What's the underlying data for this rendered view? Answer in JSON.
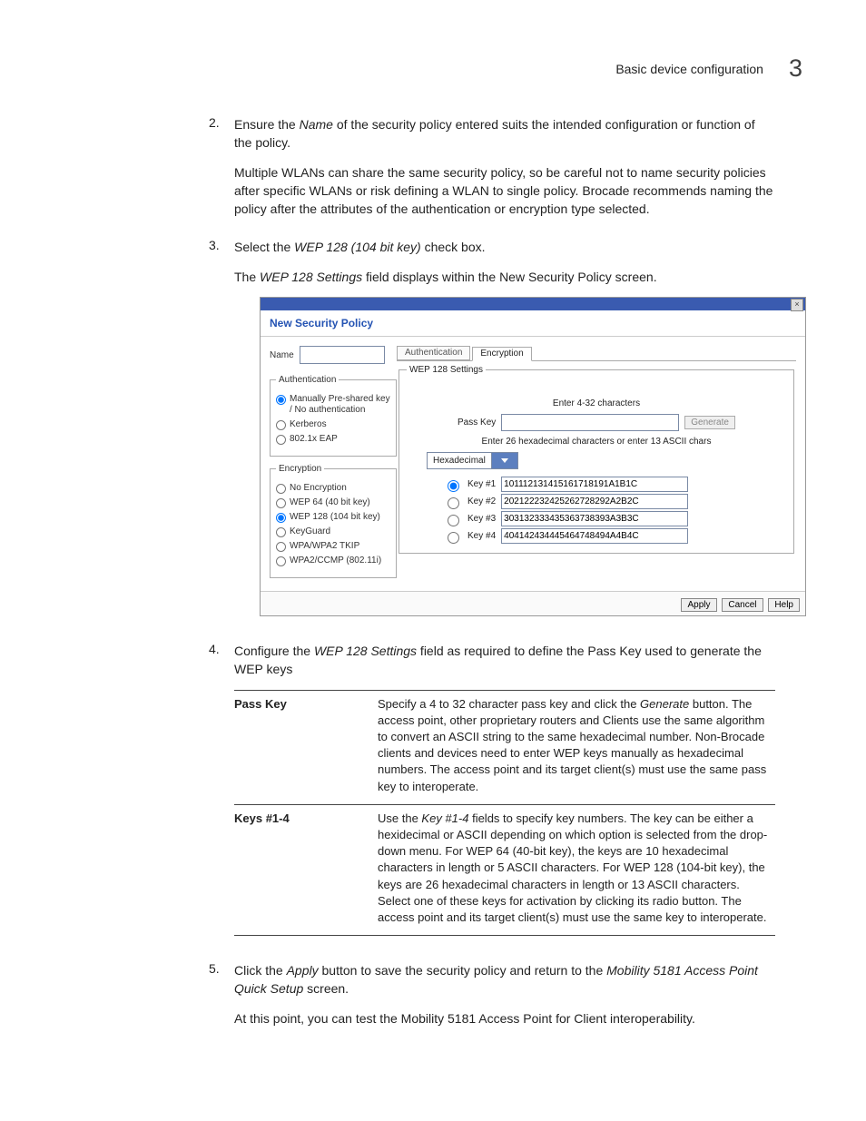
{
  "header": {
    "section": "Basic device configuration",
    "chapter": "3"
  },
  "steps": {
    "s2": {
      "num": "2.",
      "text_a": "Ensure the ",
      "name_em": "Name",
      "text_b": " of the security policy entered suits the intended configuration or function of the policy.",
      "sub": "Multiple WLANs can share the same security policy, so be careful not to name security policies after specific WLANs or risk defining a WLAN to single policy. Brocade recommends naming the policy after the attributes of the authentication or encryption type selected."
    },
    "s3": {
      "num": "3.",
      "text_a": "Select the ",
      "wep_em": "WEP 128 (104 bit key)",
      "text_b": " check box.",
      "sub_a": "The ",
      "sub_em": "WEP 128 Settings",
      "sub_b": " field displays within the New Security Policy screen."
    },
    "s4": {
      "num": "4.",
      "text_a": "Configure the ",
      "wep_em": "WEP 128 Settings",
      "text_b": " field as required to define the Pass Key used to generate the WEP keys"
    },
    "s5": {
      "num": "5.",
      "text_a": "Click the ",
      "apply_em": "Apply",
      "text_b": " button to save the security policy and return to the ",
      "dev_em": "Mobility 5181 Access Point Quick Setup",
      "text_c": " screen.",
      "sub": "At this point, you can test the Mobility 5181 Access Point for Client interoperability."
    }
  },
  "screenshot": {
    "title": "New Security Policy",
    "name_label": "Name",
    "auth": {
      "legend": "Authentication",
      "opts": [
        "Manually Pre-shared key / No authentication",
        "Kerberos",
        "802.1x EAP"
      ]
    },
    "enc": {
      "legend": "Encryption",
      "opts": [
        "No Encryption",
        "WEP 64 (40 bit key)",
        "WEP 128 (104 bit key)",
        "KeyGuard",
        "WPA/WPA2 TKIP",
        "WPA2/CCMP (802.11i)"
      ]
    },
    "tabs": {
      "auth": "Authentication",
      "enc": "Encryption"
    },
    "wep_legend": "WEP 128 Settings",
    "passkey": {
      "hint": "Enter 4-32 characters",
      "label": "Pass Key",
      "generate": "Generate"
    },
    "hexnote": "Enter 26 hexadecimal characters or enter 13 ASCII chars",
    "dropdown": "Hexadecimal",
    "keys": [
      {
        "label": "Key #1",
        "value": "101112131415161718191A1B1C"
      },
      {
        "label": "Key #2",
        "value": "202122232425262728292A2B2C"
      },
      {
        "label": "Key #3",
        "value": "303132333435363738393A3B3C"
      },
      {
        "label": "Key #4",
        "value": "404142434445464748494A4B4C"
      }
    ],
    "footer": {
      "apply": "Apply",
      "cancel": "Cancel",
      "help": "Help"
    }
  },
  "defs": {
    "passkey": {
      "label": "Pass Key",
      "text_a": "Specify a 4 to 32 character pass key and click the ",
      "gen_em": "Generate",
      "text_b": " button. The access point, other proprietary routers and Clients use the same algorithm to convert an ASCII string to the same hexadecimal number. Non-Brocade clients and devices need to enter WEP keys manually as hexadecimal numbers. The access point and its target client(s) must use the same pass key to interoperate."
    },
    "keys": {
      "label": "Keys #1-4",
      "text_a": "Use the ",
      "key_em": "Key #1-4",
      "text_b": " fields to specify key numbers. The key can be either a hexidecimal or ASCII depending on which option is selected from the drop-down menu. For WEP 64 (40-bit key), the keys are 10 hexadecimal characters in length or 5 ASCII characters. For WEP 128 (104-bit key), the keys are 26 hexadecimal characters in length or 13 ASCII characters. Select one of these keys for activation by clicking its radio button. The access point and its target client(s) must use the same key to interoperate."
    }
  }
}
